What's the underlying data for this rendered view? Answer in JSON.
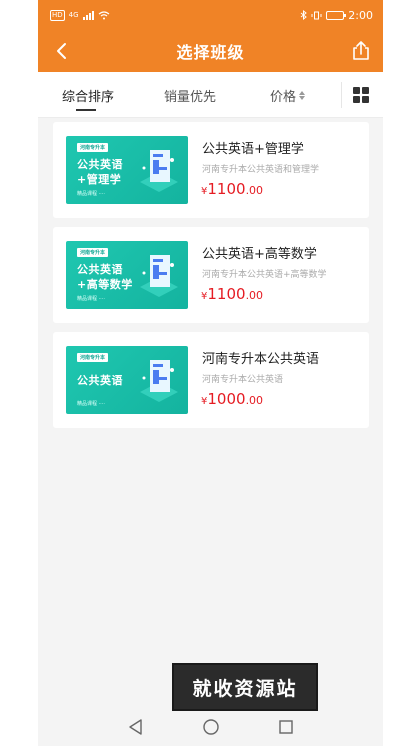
{
  "status_bar": {
    "left_badge": "HD",
    "net": "4G",
    "time": "2:00"
  },
  "header": {
    "title": "选择班级"
  },
  "tabs": [
    {
      "label": "综合排序",
      "active": true
    },
    {
      "label": "销量优先",
      "active": false
    },
    {
      "label": "价格",
      "active": false
    }
  ],
  "icons": {
    "back": "chevron-left-icon",
    "share": "share-icon",
    "sort": "sort-arrows-icon",
    "view_toggle": "grid-view-icon"
  },
  "courses": [
    {
      "title": "公共英语+管理学",
      "subtitle": "河南专升本公共英语和管理学",
      "currency": "¥",
      "price_int": "1100",
      "price_dec": ".00",
      "thumb": {
        "tag": "河南专升本",
        "line1": "公共英语",
        "line2": "+管理学",
        "foot": "精品课程 ····"
      }
    },
    {
      "title": "公共英语+高等数学",
      "subtitle": "河南专升本公共英语+高等数学",
      "currency": "¥",
      "price_int": "1100",
      "price_dec": ".00",
      "thumb": {
        "tag": "河南专升本",
        "line1": "公共英语",
        "line2": "+高等数学",
        "foot": "精品课程 ····"
      }
    },
    {
      "title": "河南专升本公共英语",
      "subtitle": "河南专升本公共英语",
      "currency": "¥",
      "price_int": "1000",
      "price_dec": ".00",
      "thumb": {
        "tag": "河南专升本",
        "line1": "公共英语",
        "line2": "",
        "foot": "精品课程 ····"
      }
    }
  ],
  "watermark": {
    "text": "就收资源站"
  },
  "colors": {
    "brand": "#f08326",
    "price": "#e51c23",
    "thumb": "#1fc7b0"
  }
}
